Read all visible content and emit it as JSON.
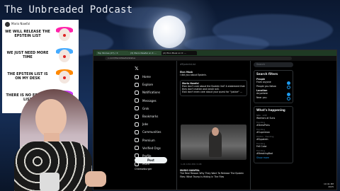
{
  "stream": {
    "title": "The Unbreaded Podcast"
  },
  "tweet_card": {
    "account": "Mario Nawfal",
    "lines": [
      "WE WILL RELEASE THE EPSTEIN LIST",
      "WE JUST NEED MORE TIME",
      "THE EPSTEIN LIST IS ON MY DESK",
      "THERE IS NO EPSTEIN LIST"
    ]
  },
  "browser": {
    "tabs": [
      "Top Stories (27) / X",
      "(3) Mario Nawfal on X: ...",
      "(2) Elon Musk on X: ..."
    ],
    "address": "x.com/MarioNawfal/status"
  },
  "x_app": {
    "nav": [
      "Home",
      "Explore",
      "Notifications",
      "Messages",
      "Grok",
      "Bookmarks",
      "Jobs",
      "Communities",
      "Premium",
      "Verified Orgs",
      "Profile",
      "More"
    ],
    "nav_icons": [
      "home-icon",
      "search-icon",
      "bell-icon",
      "mail-icon",
      "grok-icon",
      "bookmark-icon",
      "briefcase-icon",
      "people-icon",
      "x-icon",
      "lightning-icon",
      "person-icon",
      "more-icon"
    ],
    "post_label": "Post",
    "account_name": "Cheeseburger",
    "feed_header": "#EpsteinList",
    "tweet_author": "Elon Musk",
    "tweet_text": "I did you about Epstein.",
    "quote_author": "Mario Nawfal",
    "quote_text": "Elon don't care about the Epstein list? A statement that they don't matter and never will.",
    "quote_subtext": "Elon don't even care about your quest for \"justice\" ...",
    "video_stats": "1.2K   4.5K   25K   3.1M",
    "second_tweet_author": "MARIO NAWFAL",
    "second_tweet_text": "The Real Reason Why They Want To Release The Epstein Files: What Trump Is Hiding In The Files"
  },
  "sidebar_right": {
    "search_placeholder": "Search",
    "filters_title": "Search filters",
    "people_label": "People",
    "people_options": [
      "From anyone",
      "People you follow"
    ],
    "location_label": "Location",
    "location_options": [
      "Anywhere",
      "Near you"
    ],
    "happening_title": "What's happening",
    "trends": [
      {
        "name": "Warriors at Suns",
        "sub": "NBA · LIVE"
      },
      {
        "name": "#DrewPicks",
        "sub": "Trending"
      },
      {
        "name": "#Superman",
        "sub": "Trending"
      },
      {
        "name": "#Eppstein",
        "sub": "Politics · Trending"
      },
      {
        "name": "Fell Color",
        "sub": "Trending"
      },
      {
        "name": "#BreakingBad",
        "sub": "Trending"
      }
    ],
    "show_more": "Show more"
  },
  "taskbar": {
    "time": "10:41 PM",
    "date": "2025"
  }
}
